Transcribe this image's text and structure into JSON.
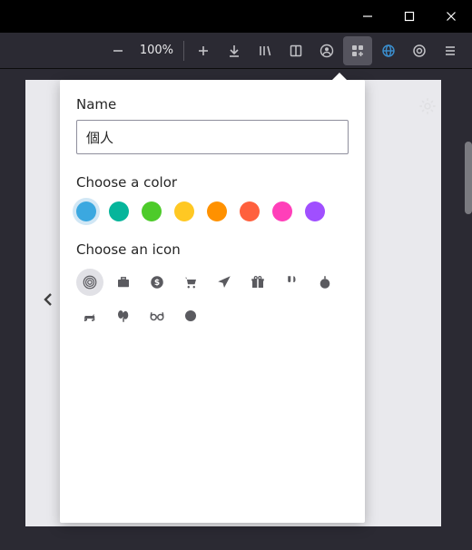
{
  "titlebar": {
    "minimize": "minimize",
    "maximize": "maximize",
    "close": "close"
  },
  "toolbar": {
    "zoom_out": "zoom-out",
    "zoom_label": "100%",
    "zoom_in": "zoom-in",
    "downloads": "downloads",
    "library": "library",
    "reader": "reader-view",
    "account": "account",
    "containers": "containers",
    "web": "web",
    "extension": "extension",
    "menu": "app-menu"
  },
  "panel": {
    "name_label": "Name",
    "name_value": "個人",
    "color_label": "Choose a color",
    "colors": [
      {
        "name": "blue",
        "hex": "#3ba8e0",
        "selected": true
      },
      {
        "name": "teal",
        "hex": "#06b59b",
        "selected": false
      },
      {
        "name": "green",
        "hex": "#4dcb2a",
        "selected": false
      },
      {
        "name": "yellow",
        "hex": "#ffc823",
        "selected": false
      },
      {
        "name": "orange",
        "hex": "#ff9100",
        "selected": false
      },
      {
        "name": "red",
        "hex": "#ff603d",
        "selected": false
      },
      {
        "name": "pink",
        "hex": "#ff3fb9",
        "selected": false
      },
      {
        "name": "purple",
        "hex": "#a04fff",
        "selected": false
      }
    ],
    "icon_label": "Choose an icon",
    "icons": [
      {
        "name": "fingerprint",
        "selected": true
      },
      {
        "name": "briefcase",
        "selected": false
      },
      {
        "name": "dollar",
        "selected": false
      },
      {
        "name": "cart",
        "selected": false
      },
      {
        "name": "plane",
        "selected": false
      },
      {
        "name": "gift",
        "selected": false
      },
      {
        "name": "food",
        "selected": false
      },
      {
        "name": "fruit",
        "selected": false
      },
      {
        "name": "pet",
        "selected": false
      },
      {
        "name": "tree",
        "selected": false
      },
      {
        "name": "glasses",
        "selected": false
      },
      {
        "name": "circle",
        "selected": false
      }
    ]
  },
  "content": {
    "settings": "settings",
    "back": "back"
  }
}
